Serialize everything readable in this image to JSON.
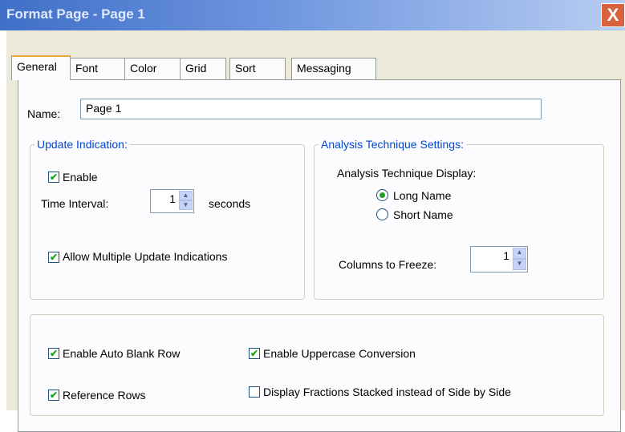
{
  "window": {
    "title": "Format Page - Page 1",
    "close_label": "X"
  },
  "tabs": [
    "General",
    "Font",
    "Color",
    "Grid",
    "Sort",
    "Messaging"
  ],
  "name_field": {
    "label": "Name:",
    "value": "Page 1"
  },
  "update_indication": {
    "legend": "Update Indication:",
    "enable_label": "Enable",
    "enable_checked": true,
    "time_interval_label": "Time Interval:",
    "time_interval_value": "1",
    "seconds_label": "seconds",
    "allow_multiple_label": "Allow Multiple Update Indications",
    "allow_multiple_checked": true
  },
  "analysis_technique": {
    "legend": "Analysis Technique Settings:",
    "display_label": "Analysis Technique Display:",
    "long_name_label": "Long Name",
    "short_name_label": "Short Name",
    "selected": "Long Name",
    "columns_freeze_label": "Columns to Freeze:",
    "columns_freeze_value": "1"
  },
  "options": {
    "auto_blank_row_label": "Enable Auto Blank Row",
    "auto_blank_row_checked": true,
    "uppercase_label": "Enable Uppercase Conversion",
    "uppercase_checked": true,
    "reference_rows_label": "Reference Rows",
    "reference_rows_checked": true,
    "fractions_label": "Display Fractions Stacked instead of Side by Side",
    "fractions_checked": false
  },
  "colors": {
    "accent": "#0046d5",
    "check": "#21a121",
    "dialog_bg": "#ece9d8"
  }
}
